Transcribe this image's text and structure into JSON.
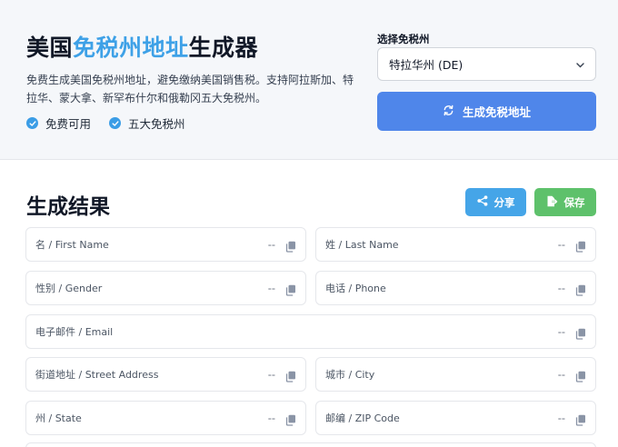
{
  "header": {
    "title_prefix": "美国",
    "title_accent": "免税州地址",
    "title_suffix": "生成器",
    "description": "免费生成美国免税州地址，避免缴纳美国销售税。支持阿拉斯加、特拉华、蒙大拿、新罕布什尔和俄勒冈五大免税州。",
    "features": [
      "免费可用",
      "五大免税州"
    ]
  },
  "state_select": {
    "label": "选择免税州",
    "selected": "特拉华州 (DE)"
  },
  "generate_button": {
    "label": "生成免税地址"
  },
  "results": {
    "title": "生成结果",
    "share_label": "分享",
    "save_label": "保存",
    "fields": {
      "first_name": {
        "label": "名 / First Name",
        "value": "--"
      },
      "last_name": {
        "label": "姓 / Last Name",
        "value": "--"
      },
      "gender": {
        "label": "性别 / Gender",
        "value": "--"
      },
      "phone": {
        "label": "电话 / Phone",
        "value": "--"
      },
      "email": {
        "label": "电子邮件 / Email",
        "value": "--"
      },
      "street": {
        "label": "街道地址 / Street Address",
        "value": "--"
      },
      "city": {
        "label": "城市 / City",
        "value": "--"
      },
      "state": {
        "label": "州 / State",
        "value": "--"
      },
      "zip": {
        "label": "邮编 / ZIP Code",
        "value": "--"
      }
    }
  },
  "colors": {
    "accent_blue": "#3ea1e7",
    "generate_button": "#4f86ea",
    "share_button": "#45a5e8",
    "save_button": "#5ec16b"
  }
}
